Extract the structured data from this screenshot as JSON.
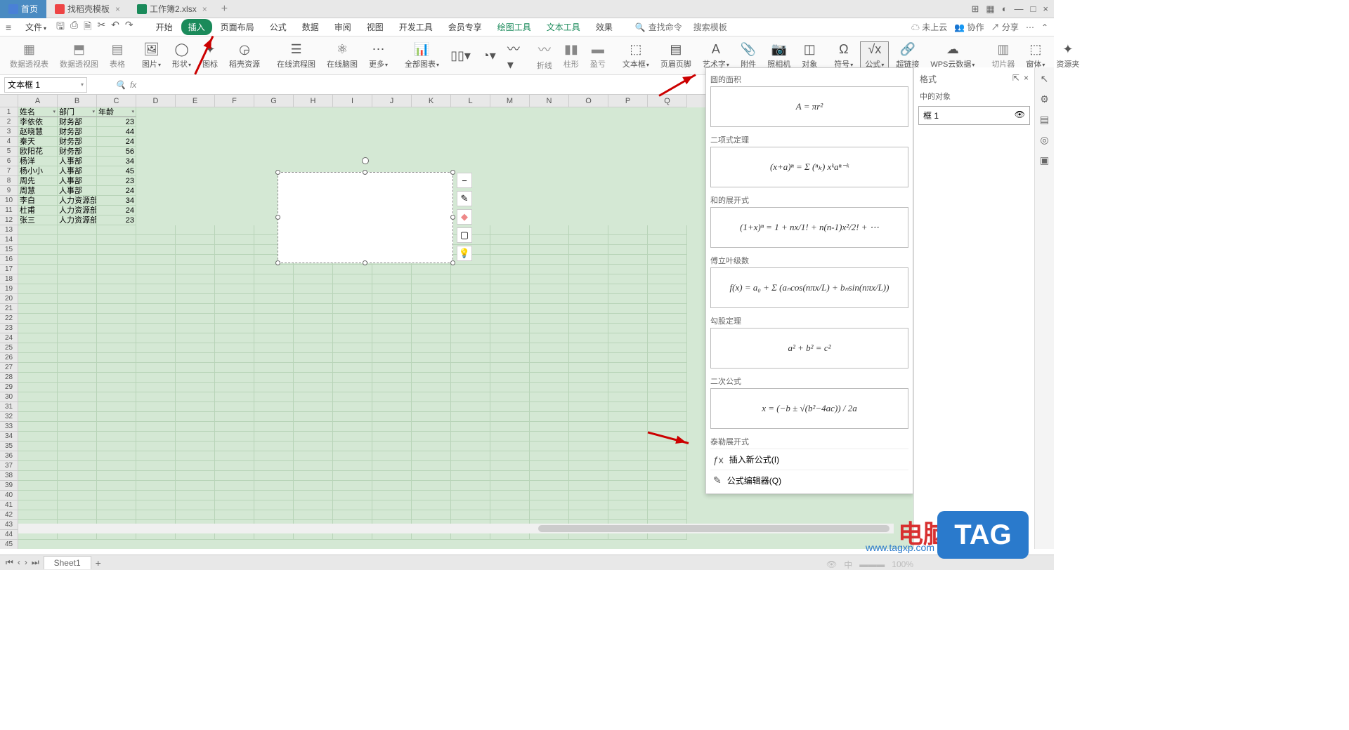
{
  "tabs": {
    "home": "首页",
    "template": "找稻壳模板",
    "workbook": "工作簿2.xlsx"
  },
  "menu": {
    "file": "文件",
    "start": "开始",
    "insert": "插入",
    "pagelayout": "页面布局",
    "formula": "公式",
    "data": "数据",
    "review": "审阅",
    "view": "视图",
    "dev": "开发工具",
    "member": "会员专享",
    "draw": "绘图工具",
    "text": "文本工具",
    "effect": "效果"
  },
  "search": {
    "cmd": "查找命令",
    "tpl": "搜索模板"
  },
  "rightm": {
    "cloud": "未上云",
    "collab": "协作",
    "share": "分享"
  },
  "ribbon": {
    "pivottable": "数据透视表",
    "pivotchart": "数据透视图",
    "table": "表格",
    "picture": "图片",
    "shape": "形状",
    "icons": "图标",
    "daores": "稻壳资源",
    "onlineflow": "在线流程图",
    "mindmap": "在线脑图",
    "more": "更多",
    "allcharts": "全部图表",
    "breakline": "折线",
    "bar": "柱形",
    "profit": "盈亏",
    "textframe": "文本框",
    "headerfooter": "页眉页脚",
    "wordart": "艺术字",
    "attach": "附件",
    "camera": "照相机",
    "object": "对象",
    "symbol": "符号",
    "equation": "公式",
    "hyperlink": "超链接",
    "wpscloud": "WPS云数据",
    "slicer": "切片器",
    "window": "窗体",
    "resource": "资源夹"
  },
  "namebox": "文本框 1",
  "headers": {
    "a": "姓名",
    "b": "部门",
    "c": "年龄"
  },
  "rows": [
    {
      "a": "李依依",
      "b": "财务部",
      "c": "23"
    },
    {
      "a": "赵晓慧",
      "b": "财务部",
      "c": "44"
    },
    {
      "a": "秦天",
      "b": "财务部",
      "c": "24"
    },
    {
      "a": "欧阳花",
      "b": "财务部",
      "c": "56"
    },
    {
      "a": "杨洋",
      "b": "人事部",
      "c": "34"
    },
    {
      "a": "杨小小",
      "b": "人事部",
      "c": "45"
    },
    {
      "a": "周先",
      "b": "人事部",
      "c": "23"
    },
    {
      "a": "周慧",
      "b": "人事部",
      "c": "24"
    },
    {
      "a": "李白",
      "b": "人力资源部",
      "c": "34"
    },
    {
      "a": "杜甫",
      "b": "人力资源部",
      "c": "24"
    },
    {
      "a": "张三",
      "b": "人力资源部",
      "c": "23"
    }
  ],
  "cols": [
    "A",
    "B",
    "C",
    "D",
    "E",
    "F",
    "G",
    "H",
    "I",
    "J",
    "K",
    "L",
    "M",
    "N",
    "O",
    "P",
    "Q"
  ],
  "fp": {
    "s1": "圆的面积",
    "f1": "A = πr²",
    "s2": "二项式定理",
    "f2": "(x+a)ⁿ = Σ (ⁿₖ) xᵏaⁿ⁻ᵏ",
    "s3": "和的展开式",
    "f3": "(1+x)ⁿ = 1 + nx/1! + n(n-1)x²/2! + ⋯",
    "s4": "傅立叶级数",
    "f4": "f(x) = a₀ + Σ (aₙcos(nπx/L) + bₙsin(nπx/L))",
    "s5": "勾股定理",
    "f5": "a² + b² = c²",
    "s6": "二次公式",
    "f6": "x = (−b ± √(b²−4ac)) / 2a",
    "s7": "泰勒展开式",
    "opt1": "插入新公式(I)",
    "opt2": "公式编辑器(Q)"
  },
  "rpane": {
    "title": "格式",
    "obj": "中的对象",
    "item": "框 1"
  },
  "sheet": "Sheet1",
  "wm": {
    "txt": "电脑技术网",
    "url": "www.tagxp.com",
    "tag": "TAG"
  },
  "statusfaint": {
    "ime": "中",
    "zoom": "100%"
  }
}
